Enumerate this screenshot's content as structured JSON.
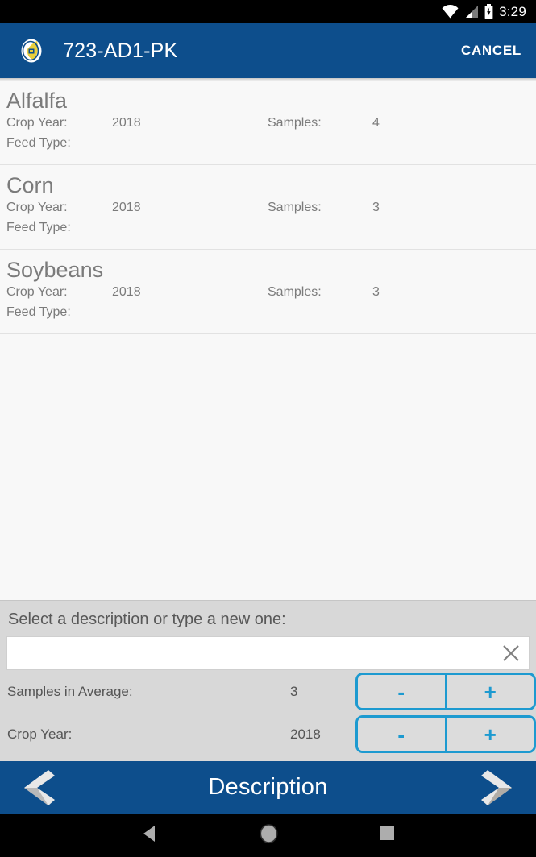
{
  "status_bar": {
    "time": "3:29",
    "icons": [
      "wifi-icon",
      "signal-icon",
      "battery-charging-icon"
    ]
  },
  "app_bar": {
    "logo": "app-logo-icon",
    "title": "723-AD1-PK",
    "cancel_label": "CANCEL",
    "background_color": "#0d4e8c"
  },
  "list": {
    "labels": {
      "crop_year": "Crop Year:",
      "feed_type": "Feed Type:",
      "samples": "Samples:"
    },
    "rows": [
      {
        "name": "Alfalfa",
        "crop_year": "2018",
        "samples": "4",
        "feed_type": ""
      },
      {
        "name": "Corn",
        "crop_year": "2018",
        "samples": "3",
        "feed_type": ""
      },
      {
        "name": "Soybeans",
        "crop_year": "2018",
        "samples": "3",
        "feed_type": ""
      }
    ]
  },
  "panel": {
    "prompt": "Select a description or type a new one:",
    "description_input": {
      "value": "",
      "placeholder": ""
    },
    "clear_icon": "close-icon",
    "steppers": [
      {
        "label": "Samples in Average:",
        "value": "3",
        "minus": "-",
        "plus": "+"
      },
      {
        "label": "Crop Year:",
        "value": "2018",
        "minus": "-",
        "plus": "+"
      }
    ],
    "background_color": "#d8d8d8",
    "accent_color": "#1d9ad0"
  },
  "bottom_nav": {
    "prev_icon": "chevron-left-icon",
    "title": "Description",
    "next_icon": "chevron-right-icon"
  },
  "system_nav": {
    "back": "back-triangle-icon",
    "home": "home-circle-icon",
    "recents": "recents-square-icon"
  }
}
